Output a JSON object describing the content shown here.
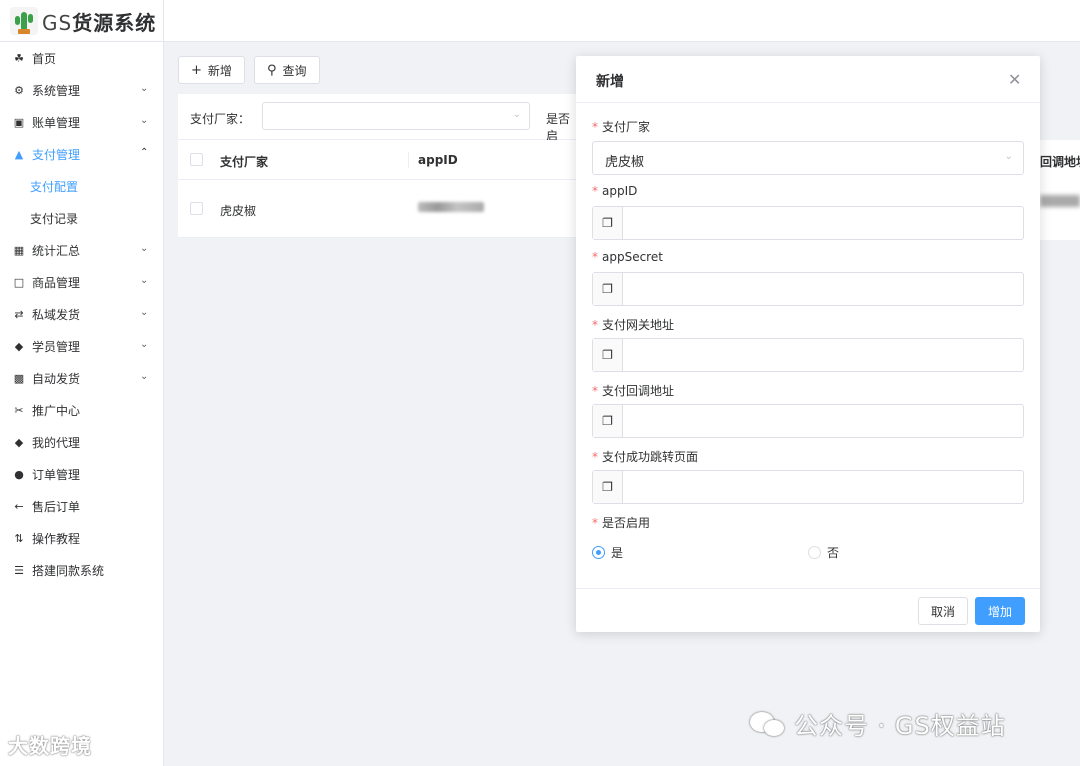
{
  "app": {
    "logo_prefix": "GS",
    "logo_title": "货源系统"
  },
  "sidebar": {
    "items": [
      {
        "label": "首页",
        "icon": "home-icon"
      },
      {
        "label": "系统管理",
        "icon": "gears-icon"
      },
      {
        "label": "账单管理",
        "icon": "money-icon"
      },
      {
        "label": "支付管理",
        "icon": "graduation-cap-icon"
      },
      {
        "label": "支付配置"
      },
      {
        "label": "支付记录"
      },
      {
        "label": "统计汇总",
        "icon": "table-icon"
      },
      {
        "label": "商品管理",
        "icon": "calendar-icon"
      },
      {
        "label": "私域发货",
        "icon": "shuffle-icon"
      },
      {
        "label": "学员管理",
        "icon": "tag-icon"
      },
      {
        "label": "自动发货",
        "icon": "car-icon"
      },
      {
        "label": "推广中心",
        "icon": "scissors-icon"
      },
      {
        "label": "我的代理",
        "icon": "tag-icon"
      },
      {
        "label": "订单管理",
        "icon": "cube-icon"
      },
      {
        "label": "售后订单",
        "icon": "arrow-left-icon"
      },
      {
        "label": "操作教程",
        "icon": "sort-icon"
      },
      {
        "label": "搭建同款系统",
        "icon": "list-icon"
      }
    ]
  },
  "toolbar": {
    "add_label": "新增",
    "query_label": "查询"
  },
  "filter": {
    "vendor_label": "支付厂家：",
    "enabled_label": "是否启"
  },
  "table": {
    "headers": [
      "支付厂家",
      "appID"
    ],
    "rows": [
      {
        "vendor": "虎皮椒"
      }
    ],
    "peek_header": "回调地址"
  },
  "dialog": {
    "title": "新增",
    "fields": {
      "vendor_label": "支付厂家",
      "vendor_value": "虎皮椒",
      "appid_label": "appID",
      "appsecret_label": "appSecret",
      "gateway_label": "支付网关地址",
      "callback_label": "支付回调地址",
      "success_label": "支付成功跳转页面",
      "enabled_label": "是否启用",
      "yes": "是",
      "no": "否"
    },
    "cancel_label": "取消",
    "submit_label": "增加"
  },
  "watermarks": {
    "left": "大数跨境",
    "right": "公众号 · GS权益站"
  },
  "colors": {
    "primary": "#409eff",
    "required": "#f56c6c"
  }
}
